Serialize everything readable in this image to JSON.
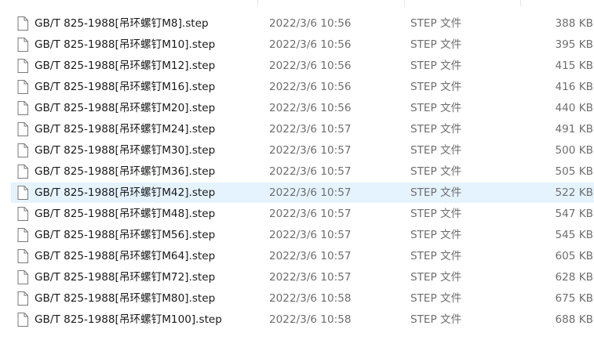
{
  "colors": {
    "hover_row": "#e5f3ff",
    "name_text": "#1a1a1a",
    "secondary_text": "#6e6e6e"
  },
  "file_icon": "generic-file-icon",
  "hovered_index": 8,
  "files": [
    {
      "name": "GB/T 825-1988[吊环螺钉M8].step",
      "date": "2022/3/6 10:56",
      "type": "STEP 文件",
      "size": "388 KB"
    },
    {
      "name": "GB/T 825-1988[吊环螺钉M10].step",
      "date": "2022/3/6 10:56",
      "type": "STEP 文件",
      "size": "395 KB"
    },
    {
      "name": "GB/T 825-1988[吊环螺钉M12].step",
      "date": "2022/3/6 10:56",
      "type": "STEP 文件",
      "size": "415 KB"
    },
    {
      "name": "GB/T 825-1988[吊环螺钉M16].step",
      "date": "2022/3/6 10:56",
      "type": "STEP 文件",
      "size": "416 KB"
    },
    {
      "name": "GB/T 825-1988[吊环螺钉M20].step",
      "date": "2022/3/6 10:56",
      "type": "STEP 文件",
      "size": "440 KB"
    },
    {
      "name": "GB/T 825-1988[吊环螺钉M24].step",
      "date": "2022/3/6 10:57",
      "type": "STEP 文件",
      "size": "491 KB"
    },
    {
      "name": "GB/T 825-1988[吊环螺钉M30].step",
      "date": "2022/3/6 10:57",
      "type": "STEP 文件",
      "size": "500 KB"
    },
    {
      "name": "GB/T 825-1988[吊环螺钉M36].step",
      "date": "2022/3/6 10:57",
      "type": "STEP 文件",
      "size": "505 KB"
    },
    {
      "name": "GB/T 825-1988[吊环螺钉M42].step",
      "date": "2022/3/6 10:57",
      "type": "STEP 文件",
      "size": "522 KB"
    },
    {
      "name": "GB/T 825-1988[吊环螺钉M48].step",
      "date": "2022/3/6 10:57",
      "type": "STEP 文件",
      "size": "547 KB"
    },
    {
      "name": "GB/T 825-1988[吊环螺钉M56].step",
      "date": "2022/3/6 10:57",
      "type": "STEP 文件",
      "size": "545 KB"
    },
    {
      "name": "GB/T 825-1988[吊环螺钉M64].step",
      "date": "2022/3/6 10:57",
      "type": "STEP 文件",
      "size": "605 KB"
    },
    {
      "name": "GB/T 825-1988[吊环螺钉M72].step",
      "date": "2022/3/6 10:57",
      "type": "STEP 文件",
      "size": "628 KB"
    },
    {
      "name": "GB/T 825-1988[吊环螺钉M80].step",
      "date": "2022/3/6 10:58",
      "type": "STEP 文件",
      "size": "675 KB"
    },
    {
      "name": "GB/T 825-1988[吊环螺钉M100].step",
      "date": "2022/3/6 10:58",
      "type": "STEP 文件",
      "size": "688 KB"
    }
  ]
}
